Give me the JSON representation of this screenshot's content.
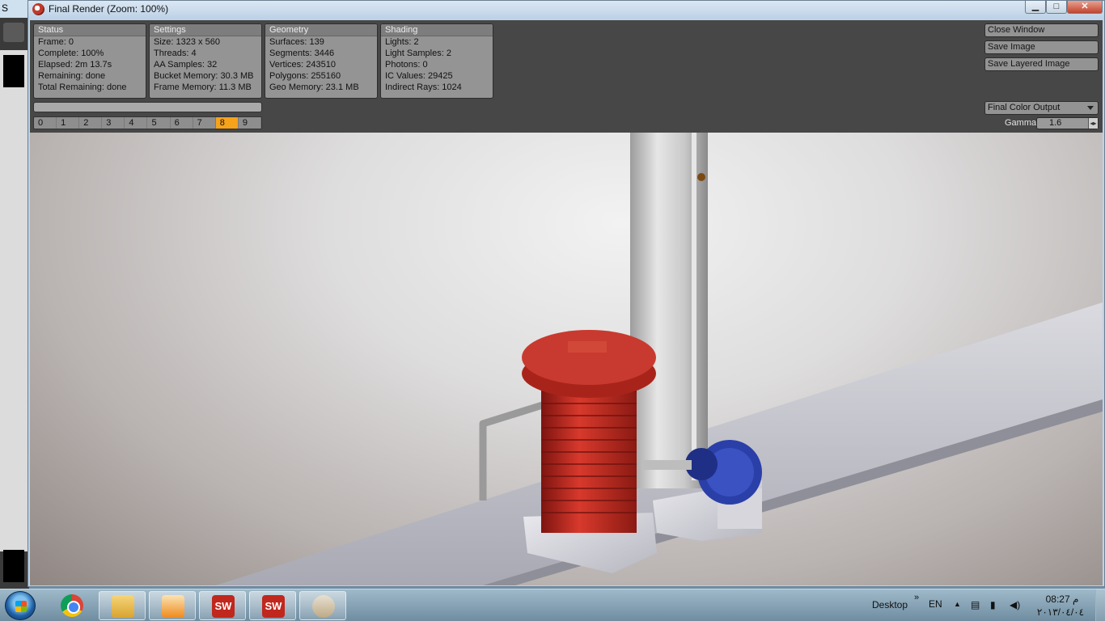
{
  "background_app": {
    "tab_fragment": "S"
  },
  "window": {
    "title": "Final Render (Zoom: 100%)",
    "minimize_glyph": "▁",
    "maximize_glyph": "□",
    "close_glyph": "✕"
  },
  "status": {
    "header": "Status",
    "rows": [
      "Frame: 0",
      "Complete: 100%",
      "Elapsed: 2m 13.7s",
      "Remaining: done",
      "Total Remaining: done"
    ]
  },
  "settings": {
    "header": "Settings",
    "rows": [
      "Size: 1323 x 560",
      "Threads: 4",
      "AA Samples: 32",
      "Bucket Memory: 30.3 MB",
      "Frame Memory: 11.3 MB"
    ]
  },
  "geometry": {
    "header": "Geometry",
    "rows": [
      "Surfaces: 139",
      "Segments: 3446",
      "Vertices: 243510",
      "Polygons: 255160",
      "Geo Memory: 23.1 MB"
    ]
  },
  "shading": {
    "header": "Shading",
    "rows": [
      "Lights: 2",
      "Light Samples: 2",
      "Photons: 0",
      "IC Values: 29425",
      "Indirect Rays: 1024"
    ]
  },
  "progress": {
    "fraction": 0
  },
  "frames": {
    "items": [
      "0",
      "1",
      "2",
      "3",
      "4",
      "5",
      "6",
      "7",
      "8",
      "9"
    ],
    "selected": "8",
    "selected_color": "#f7a21b"
  },
  "buttons": {
    "close_window": "Close Window",
    "save_image": "Save Image",
    "save_layered": "Save Layered Image"
  },
  "output": {
    "selected": "Final Color Output"
  },
  "gamma": {
    "label": "Gamma",
    "value": "1.6"
  },
  "taskbar": {
    "items": [
      "chrome-icon",
      "file-explorer-icon",
      "media-player-icon",
      "solidworks-icon",
      "solidworks-render-icon",
      "paint-icon"
    ],
    "sw_label": "SW",
    "desktop_label": "Desktop",
    "chevron": "»",
    "language": "EN",
    "time": "08:27 م",
    "date": "٢٠١٣/٠٤/٠٤"
  },
  "colors": {
    "accent": "#f7a21b",
    "cylinder_red": "#c0271d",
    "gear_blue": "#2a3fa8"
  }
}
